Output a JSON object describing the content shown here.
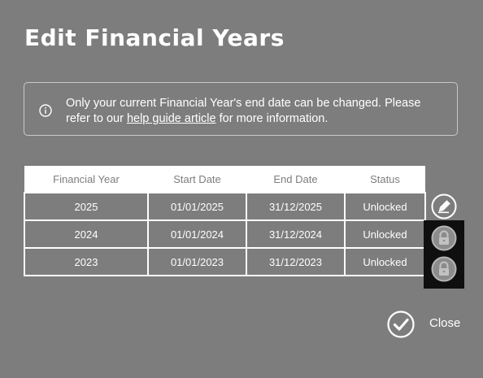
{
  "page": {
    "title": "Edit Financial Years"
  },
  "info": {
    "text_before": "Only your current Financial Year's end date can be changed. Please refer to our ",
    "link_text": "help guide article",
    "text_after": " for more information.",
    "icon": "info-icon"
  },
  "table": {
    "headers": [
      "Financial Year",
      "Start Date",
      "End Date",
      "Status"
    ],
    "rows": [
      {
        "year": "2025",
        "start": "01/01/2025",
        "end": "31/12/2025",
        "status": "Unlocked",
        "action": "edit-icon"
      },
      {
        "year": "2024",
        "start": "01/01/2024",
        "end": "31/12/2024",
        "status": "Unlocked",
        "action": "lock-icon"
      },
      {
        "year": "2023",
        "start": "01/01/2023",
        "end": "31/12/2023",
        "status": "Unlocked",
        "action": "lock-icon"
      }
    ]
  },
  "footer": {
    "close_label": "Close",
    "close_icon": "checkmark-circle-icon"
  },
  "colors": {
    "background": "#7d7d7d",
    "text": "#ffffff",
    "header_text": "#7d7d7d",
    "highlight_box": "#0f0f0f"
  }
}
